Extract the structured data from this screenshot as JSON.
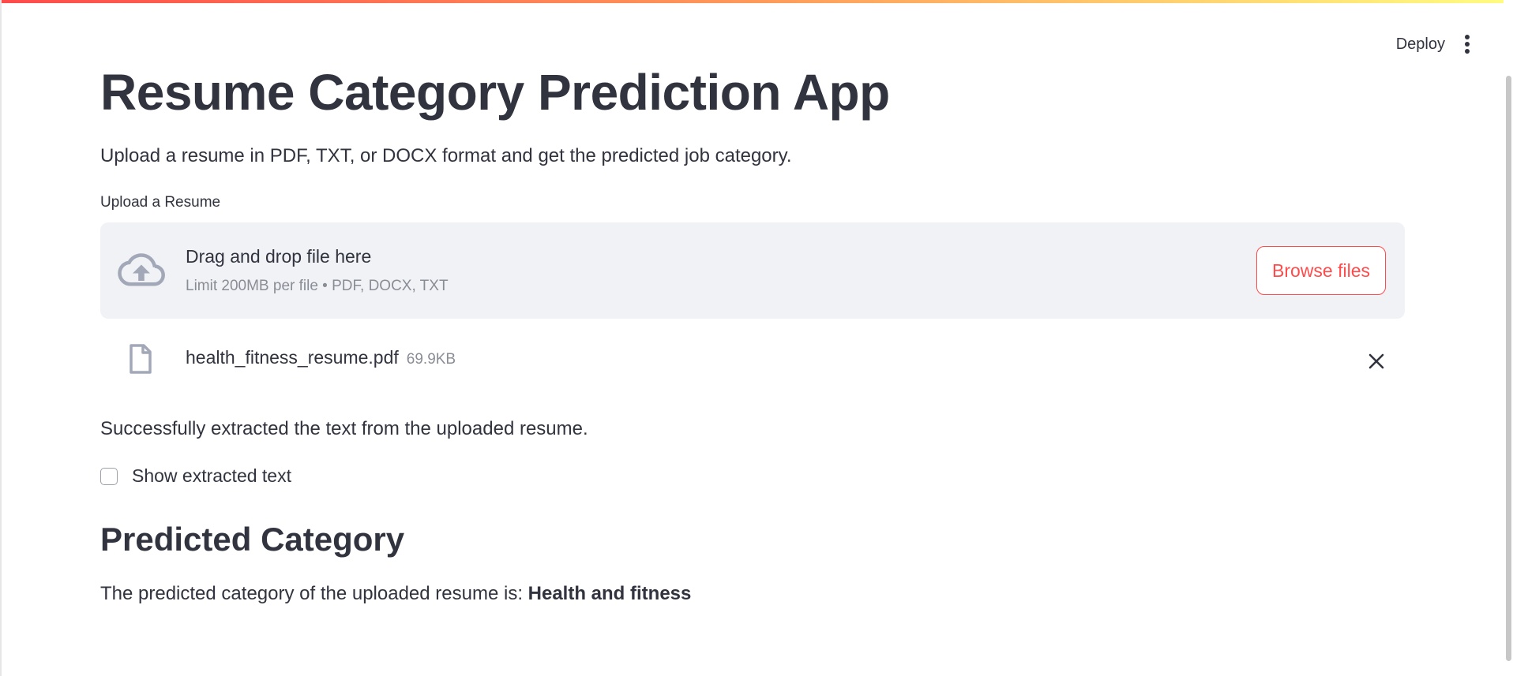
{
  "header": {
    "deploy_label": "Deploy",
    "menu_icon": "kebab-menu-icon"
  },
  "main": {
    "title": "Resume Category Prediction App",
    "subtitle": "Upload a resume in PDF, TXT, or DOCX format and get the predicted job category.",
    "uploader": {
      "label": "Upload a Resume",
      "icon": "cloud-upload-icon",
      "drag_text": "Drag and drop file here",
      "limit_text": "Limit 200MB per file • PDF, DOCX, TXT",
      "browse_label": "Browse files"
    },
    "uploaded_file": {
      "icon": "file-icon",
      "name": "health_fitness_resume.pdf",
      "size": "69.9KB",
      "remove_icon": "close-icon"
    },
    "status_message": "Successfully extracted the text from the uploaded resume.",
    "show_text_checkbox": {
      "label": "Show extracted text",
      "checked": false
    },
    "section_heading": "Predicted Category",
    "result_prefix": "The predicted category of the uploaded resume is: ",
    "result_value": "Health and fitness"
  },
  "colors": {
    "accent": "#ff4b4b",
    "text": "#31333f",
    "muted": "#8a8d95",
    "dropzone_bg": "#f0f2f6",
    "icon": "#a3a8b8"
  }
}
